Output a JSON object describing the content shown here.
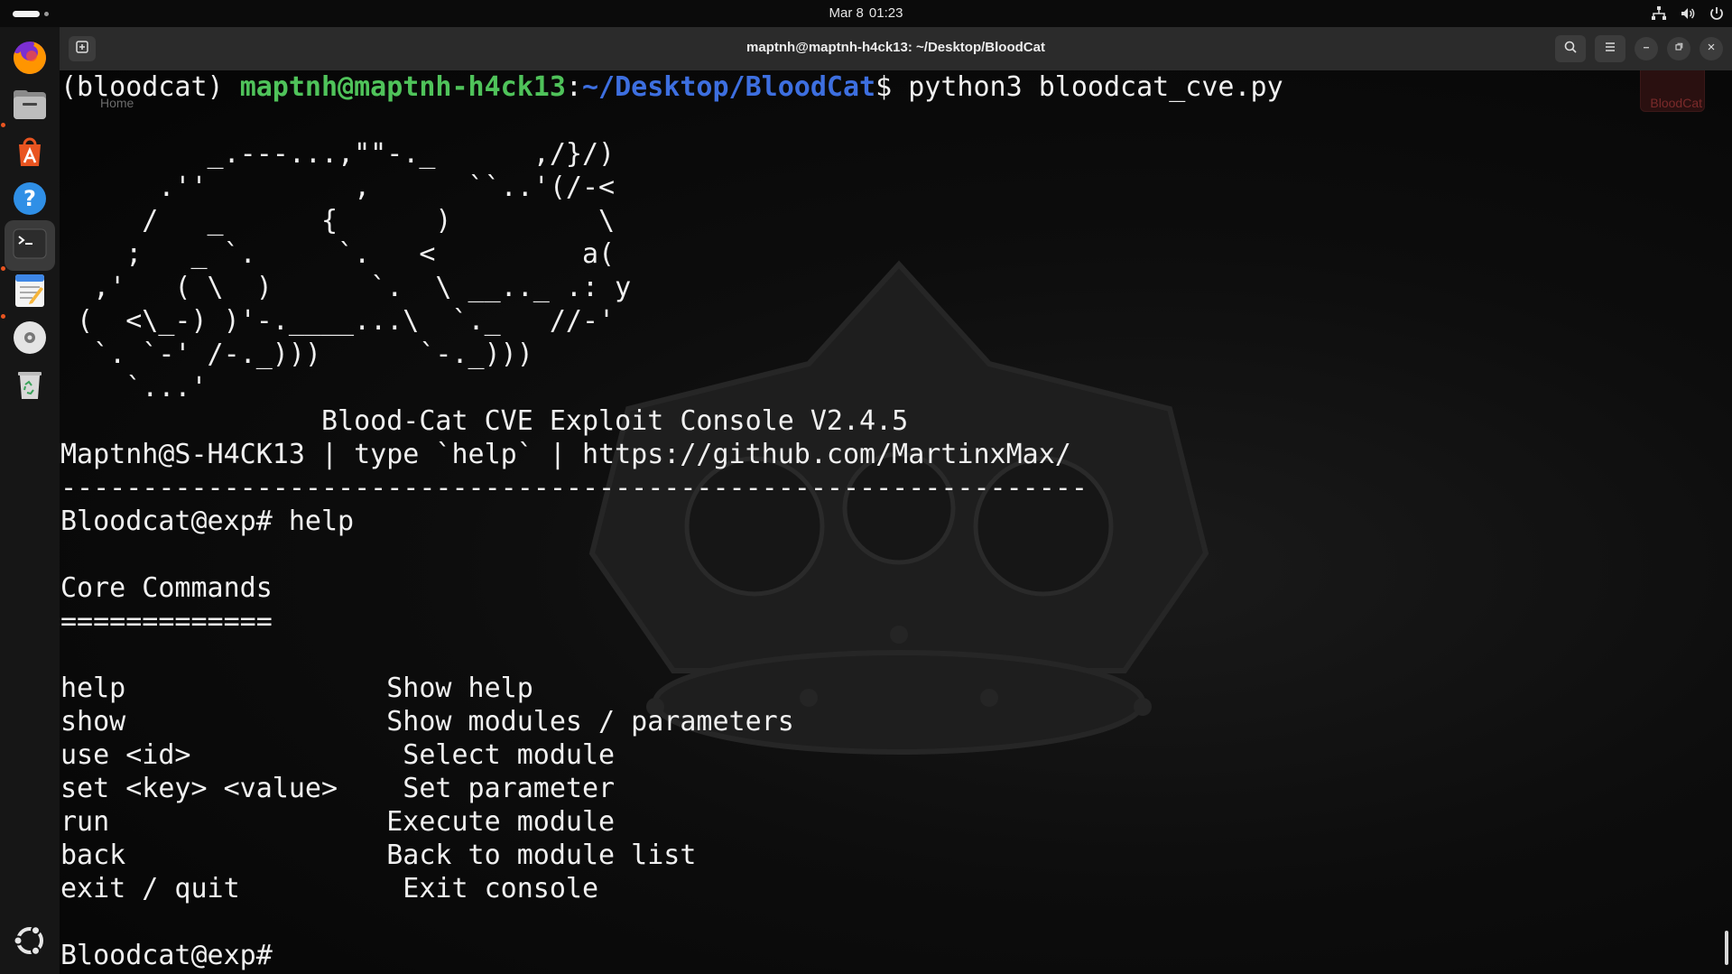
{
  "topbar": {
    "date": "Mar 8",
    "time": "01:23",
    "tray_icons": [
      "network-icon",
      "volume-icon",
      "power-icon"
    ]
  },
  "dock": {
    "items": [
      {
        "name": "firefox",
        "icon": "firefox-icon",
        "running": false
      },
      {
        "name": "files",
        "icon": "files-icon",
        "running": true
      },
      {
        "name": "app-center",
        "icon": "app-center-icon",
        "running": false
      },
      {
        "name": "help",
        "icon": "help-icon",
        "running": false
      },
      {
        "name": "terminal",
        "icon": "terminal-icon",
        "running": true,
        "active": true
      },
      {
        "name": "text-editor",
        "icon": "text-editor-icon",
        "running": true
      },
      {
        "name": "disc",
        "icon": "disc-icon",
        "running": false
      },
      {
        "name": "trash",
        "icon": "trash-icon",
        "running": false
      }
    ],
    "apps_grid_icon": "ubuntu-logo-icon"
  },
  "window": {
    "title": "maptnh@maptnh-h4ck13: ~/Desktop/BloodCat"
  },
  "desktop": {
    "home_label": "Home",
    "folder_label": "BloodCat"
  },
  "terminal": {
    "prompt_env": "(bloodcat) ",
    "prompt_userhost": "maptnh@maptnh-h4ck13",
    "prompt_colon": ":",
    "prompt_path": "~/Desktop/BloodCat",
    "prompt_dollar": "$ ",
    "command": "python3 bloodcat_cve.py",
    "ascii_art": [
      "         _.---...,\"\"-._      ,/}/)",
      "      .''         ,      ``..'(/-<",
      "     /   _      {      )         \\",
      "    ;   _ `.     `.   <         a(",
      "  ,'   ( \\  )      `.  \\ __.._ .: y",
      " (  <\\_-) )'-.____...\\  `._   //-'",
      "  `. `-' /-._)))      `-._)))",
      "    `...'"
    ],
    "banner_title": "                Blood-Cat CVE Exploit Console V2.4.5",
    "banner_info": "Maptnh@S-H4CK13 | type `help` | https://github.com/MartinxMax/",
    "separator": "---------------------------------------------------------------",
    "exp_prompt": "Bloodcat@exp# ",
    "entered_command": "help",
    "section_title": "Core Commands",
    "section_underline": "=============",
    "commands": [
      {
        "cmd": "help                ",
        "desc": "Show help"
      },
      {
        "cmd": "show                ",
        "desc": "Show modules / parameters"
      },
      {
        "cmd": "use <id>             ",
        "desc": "Select module"
      },
      {
        "cmd": "set <key> <value>    ",
        "desc": "Set parameter"
      },
      {
        "cmd": "run                 ",
        "desc": "Execute module"
      },
      {
        "cmd": "back                ",
        "desc": "Back to module list"
      },
      {
        "cmd": "exit / quit          ",
        "desc": "Exit console"
      }
    ],
    "final_prompt": "Bloodcat@exp#"
  },
  "colors": {
    "prompt_userhost": "#4fc35a",
    "prompt_path": "#3d6fe0",
    "terminal_text": "#f0f0f0",
    "accent": "#e95420"
  }
}
